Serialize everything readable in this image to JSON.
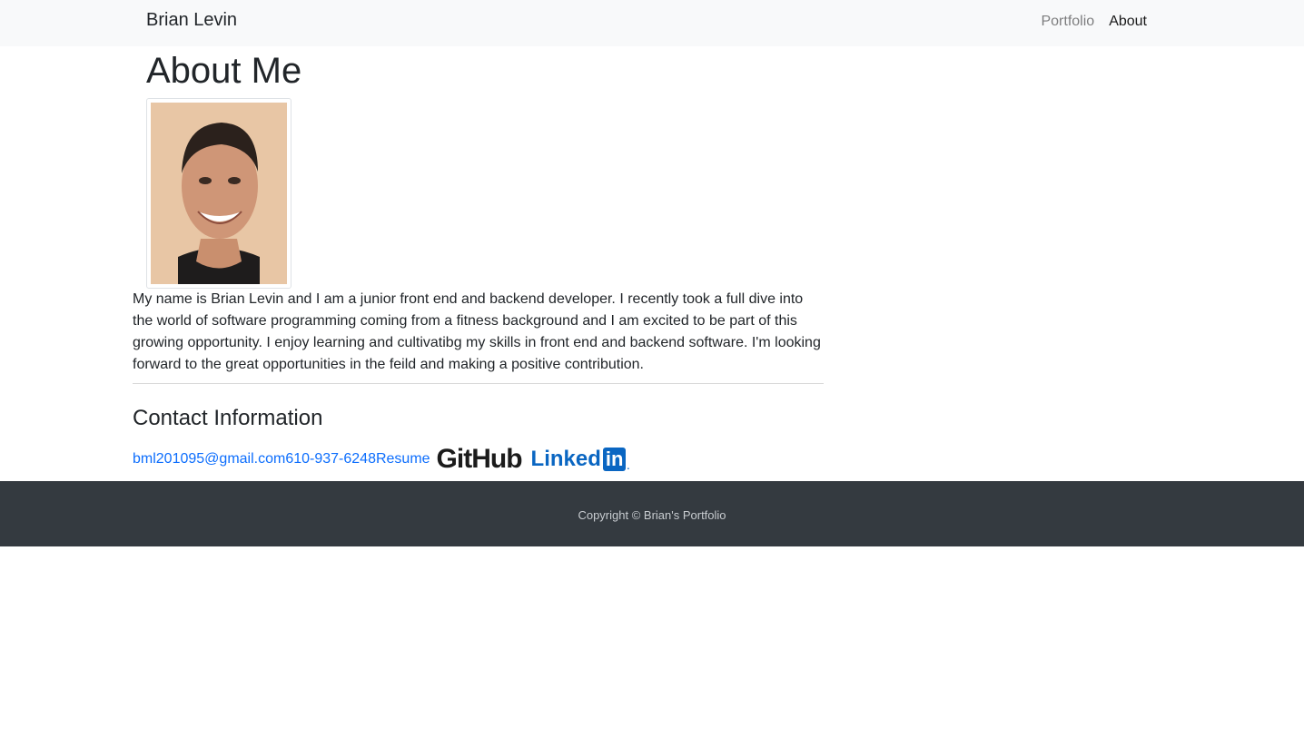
{
  "navbar": {
    "brand": "Brian Levin",
    "links": [
      {
        "label": "Portfolio",
        "active": false
      },
      {
        "label": "About",
        "active": true
      }
    ]
  },
  "main": {
    "title": "About Me",
    "photo_alt": "Brian Levin",
    "bio": "My name is Brian Levin and I am a junior front end and backend developer. I recently took a full dive into the world of software programming coming from a fitness background and I am excited to be part of this growing opportunity. I enjoy learning and cultivatibg my skills in front end and backend software. I'm looking forward to the great opportunities in the feild and making a positive contribution."
  },
  "contact": {
    "title": "Contact Information",
    "email": "bml201095@gmail.com",
    "phone": "610-937-6248",
    "resume": "Resume",
    "github_logo": "GitHub",
    "linkedin_logo_text": "Linked",
    "linkedin_logo_box": "in",
    "linkedin_logo_dot": "."
  },
  "footer": {
    "copyright": "Copyright © Brian's Portfolio"
  },
  "colors": {
    "link": "#0d6efd",
    "footer_bg": "#343a40",
    "navbar_bg": "#f8f9fa",
    "linkedin_blue": "#0a66c2"
  }
}
